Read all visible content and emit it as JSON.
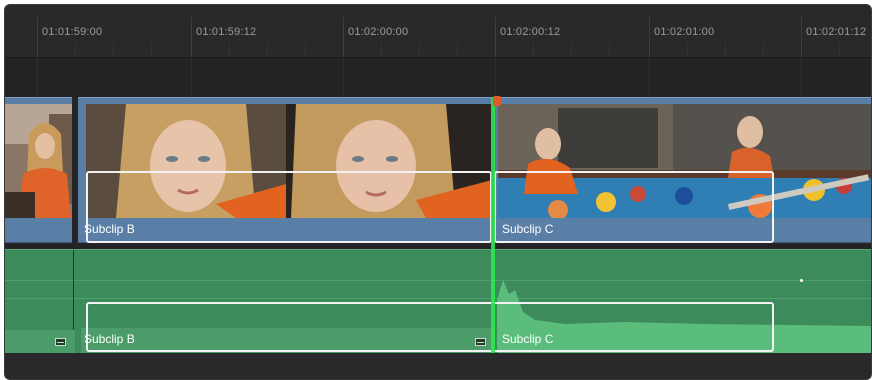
{
  "ruler": {
    "timecodes": [
      "01:01:59:00",
      "01:01:59:12",
      "01:02:00:00",
      "01:02:00:12",
      "01:02:01:00",
      "01:02:01:12"
    ]
  },
  "video_track": {
    "clips": [
      {
        "label": "Subclip B"
      },
      {
        "label": "Subclip C"
      }
    ]
  },
  "audio_track": {
    "clips": [
      {
        "label": "Subclip B"
      },
      {
        "label": "Subclip C"
      }
    ]
  },
  "colors": {
    "video_clip": "#5a7fa6",
    "audio_clip": "#3d8a5a",
    "playhead": "#2ee84e",
    "selection": "#f2f2f2"
  }
}
